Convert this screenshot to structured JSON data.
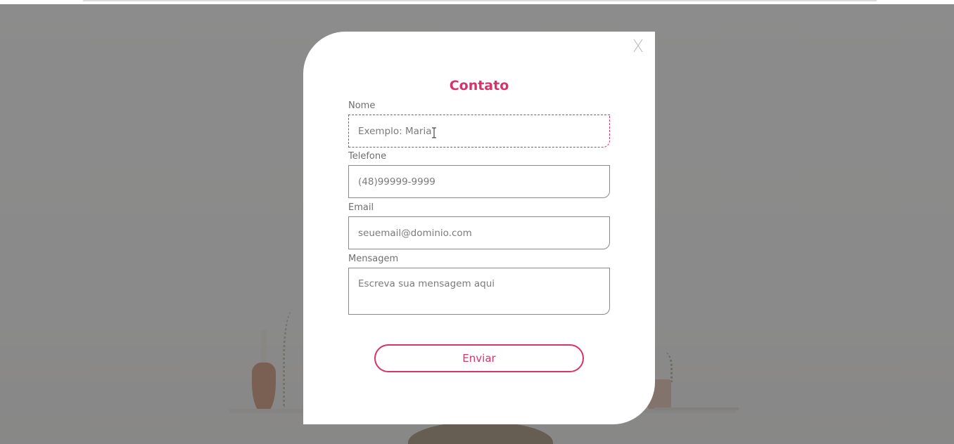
{
  "modal": {
    "close_label": "X",
    "title": "Contato",
    "fields": {
      "name": {
        "label": "Nome",
        "placeholder": "Exemplo: Maria"
      },
      "phone": {
        "label": "Telefone",
        "placeholder": "(48)99999-9999"
      },
      "email": {
        "label": "Email",
        "placeholder": "seuemail@dominio.com"
      },
      "message": {
        "label": "Mensagem",
        "placeholder": "Escreva sua mensagem aqui"
      }
    },
    "submit_label": "Enviar"
  },
  "colors": {
    "accent": "#d6336c",
    "overlay": "rgba(100,100,100,0.72)",
    "border": "#8a8a8a"
  },
  "icons": {
    "close": "close-icon",
    "cursor": "text-cursor-icon"
  }
}
